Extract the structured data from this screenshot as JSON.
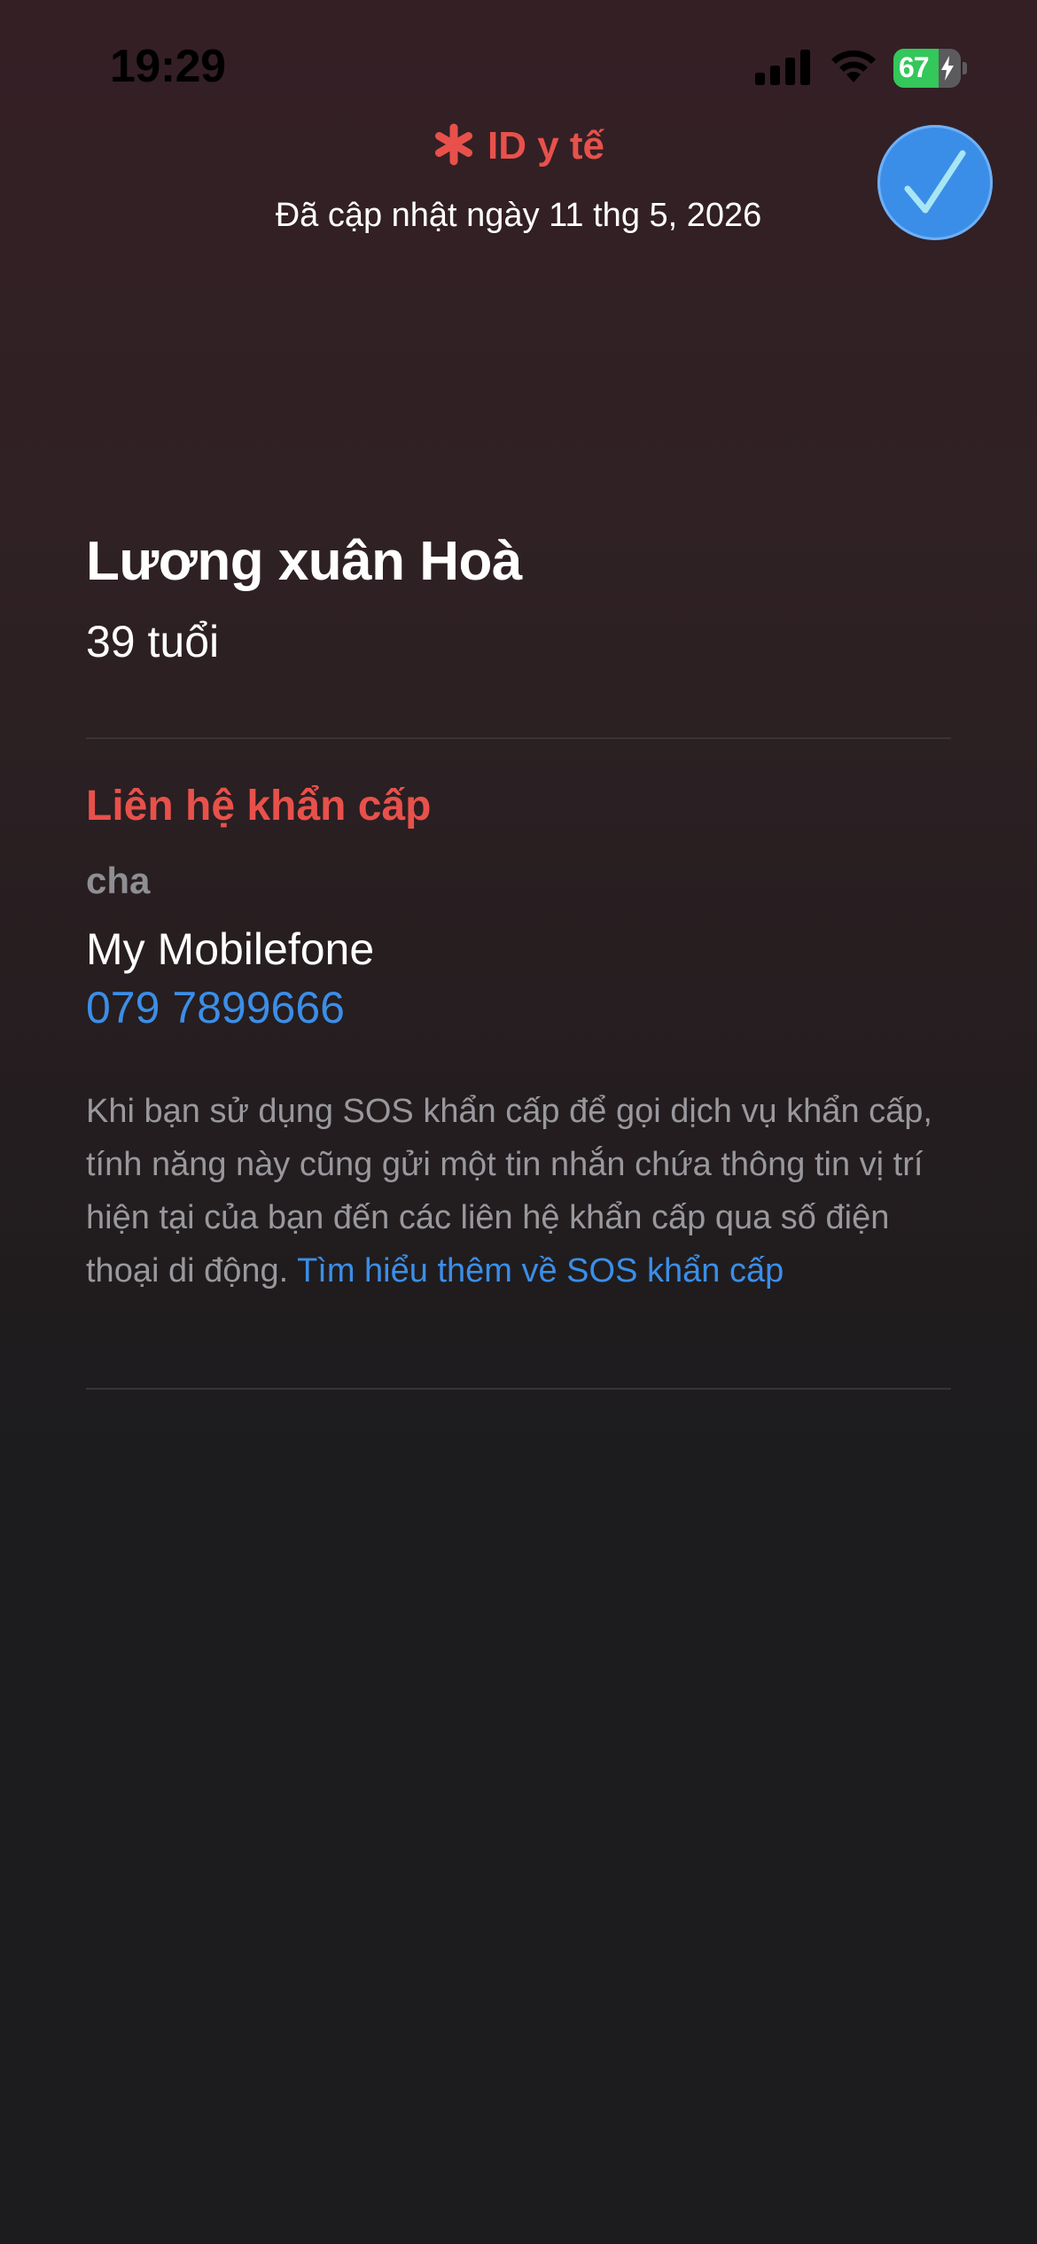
{
  "status_bar": {
    "time": "19:29",
    "battery_percent": 67,
    "battery_label": "67",
    "charging": true,
    "signal_bars": 4
  },
  "header": {
    "title": "ID y tế",
    "updated": "Đã cập nhật ngày 11 thg 5, 2026",
    "accent_color": "#e8514b",
    "done_button_color": "#3b8ee8"
  },
  "profile": {
    "name": "Lương xuân Hoà",
    "age": "39 tuổi"
  },
  "emergency_contacts": {
    "section_title": "Liên hệ khẩn cấp",
    "contacts": [
      {
        "relation": "cha",
        "name": "My Mobilefone",
        "phone": "079 7899666"
      }
    ],
    "note": "Khi bạn sử dụng SOS khẩn cấp để gọi dịch vụ khẩn cấp, tính năng này cũng gửi một tin nhắn chứa thông tin vị trí hiện tại của bạn đến các liên hệ khẩn cấp qua số điện thoại di động. ",
    "note_link": "Tìm hiểu thêm về SOS khẩn cấp",
    "link_color": "#3b8ee8"
  }
}
